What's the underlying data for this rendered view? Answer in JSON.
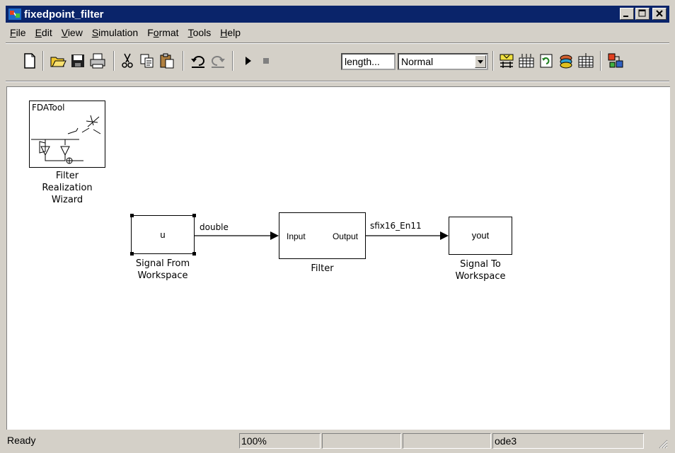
{
  "window": {
    "title": "fixedpoint_filter"
  },
  "menu": [
    "File",
    "Edit",
    "View",
    "Simulation",
    "Format",
    "Tools",
    "Help"
  ],
  "menu_mnemonics": [
    "F",
    "E",
    "V",
    "S",
    "o",
    "T",
    "H"
  ],
  "toolbar": {
    "stop_time": "length...",
    "sim_mode": "Normal"
  },
  "blocks": {
    "fdatool": {
      "icon_text": "FDATool",
      "label_lines": [
        "Filter",
        "Realization",
        "Wizard"
      ]
    },
    "source": {
      "text": "u",
      "label_lines": [
        "Signal From",
        "Workspace"
      ]
    },
    "filter": {
      "input": "Input",
      "output": "Output",
      "label": "Filter"
    },
    "sink": {
      "text": "yout",
      "label_lines": [
        "Signal To",
        "Workspace"
      ]
    }
  },
  "signals": {
    "s1": "double",
    "s2": "sfix16_En11"
  },
  "status": {
    "state": "Ready",
    "zoom": "100%",
    "solver": "ode3"
  }
}
